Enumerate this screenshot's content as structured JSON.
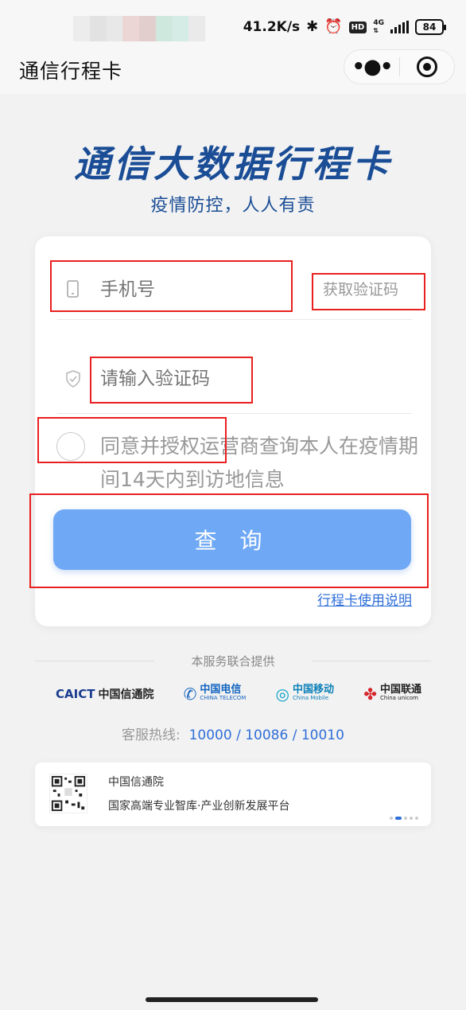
{
  "status_bar": {
    "net_speed": "41.2K/s",
    "bluetooth_icon": "bluetooth-icon",
    "alarm_icon": "alarm-icon",
    "hd_badge": "HD",
    "network": "4G",
    "battery": "84"
  },
  "title_bar": {
    "title": "通信行程卡",
    "more_icon": "more-dots-icon",
    "close_icon": "target-close-icon"
  },
  "hero": {
    "title": "通信大数据行程卡",
    "subtitle": "疫情防控，人人有责"
  },
  "form": {
    "phone_placeholder": "手机号",
    "get_code_label": "获取验证码",
    "code_placeholder": "请输入验证码",
    "agree_text": "同意并授权运营商查询本人在疫情期间14天内到访地信息",
    "query_button": "查 询",
    "guide_link": "行程卡使用说明"
  },
  "provider": {
    "label": "本服务联合提供",
    "logos": [
      {
        "name": "CAICT",
        "cn": "中国信通院"
      },
      {
        "name": "中国电信",
        "en": "CHINA TELECOM"
      },
      {
        "name": "中国移动",
        "en": "China Mobile"
      },
      {
        "name": "中国联通",
        "en": "China unicom"
      }
    ]
  },
  "hotline": {
    "label": "客服热线:",
    "numbers": [
      "10000",
      "10086",
      "10010"
    ],
    "separator": "/"
  },
  "banner": {
    "line1": "中国信通院",
    "line2": "国家高端专业智库·产业创新发展平台"
  },
  "colors": {
    "brand_blue": "#1a4d96",
    "button_blue": "#6fa8f5",
    "link_blue": "#2f6fd8",
    "annotation_red": "#e8201f"
  }
}
